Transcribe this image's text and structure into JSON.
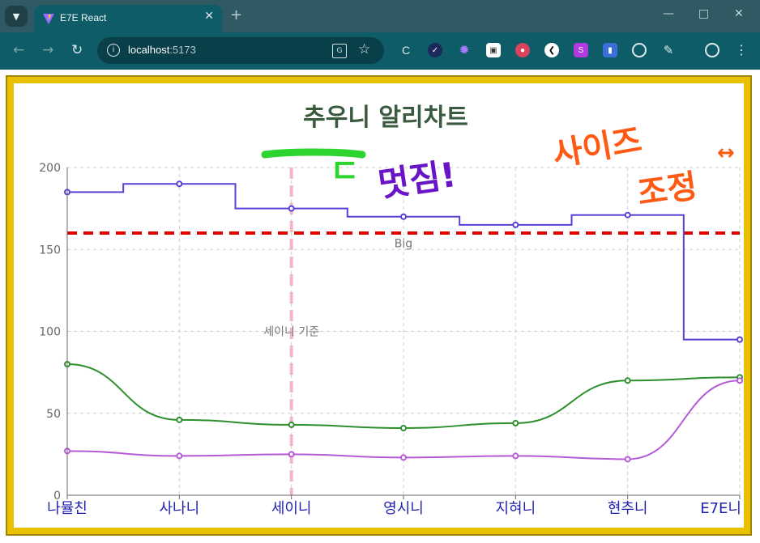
{
  "browser": {
    "tab_title": "E7E React",
    "tab_close": "✕",
    "new_tab": "+",
    "url_host": "localhost",
    "url_port": ":5173",
    "icons": {
      "tab_search": "chevron-down-icon",
      "back": "back-arrow-icon",
      "forward": "forward-arrow-icon",
      "reload": "reload-icon",
      "site_info": "info-icon",
      "translate": "translate-icon",
      "bookmark": "star-icon",
      "profile": "profile-icon",
      "menu": "kebab-menu-icon"
    },
    "colors": {
      "titlebar": "#2f5a63",
      "toolbar": "#0e5c68",
      "omnibox": "#083f48"
    }
  },
  "page": {
    "frame_color": "#e8c200",
    "annotations": {
      "green_mark": "ㅡ",
      "green_mark2": "ㄷ",
      "purple_text": "멋짐!",
      "orange_line1": "사이즈",
      "orange_line2": "조정",
      "orange_arrow": "↔"
    }
  },
  "chart_data": {
    "type": "line",
    "title": "추우니 알리차트",
    "categories": [
      "나뮬친",
      "사나니",
      "세이니",
      "영시니",
      "지혀니",
      "현추니",
      "E7E니"
    ],
    "ylim": [
      0,
      200
    ],
    "yticks": [
      0,
      50,
      100,
      150,
      200
    ],
    "grid": true,
    "series": [
      {
        "values": [
          185,
          190,
          175,
          170,
          165,
          171,
          95
        ],
        "color": "#5a3fd6",
        "interpolation": "step"
      },
      {
        "values": [
          80,
          46,
          43,
          41,
          44,
          70,
          72
        ],
        "color": "#2f8f2f",
        "interpolation": "smooth"
      },
      {
        "values": [
          27,
          24,
          25,
          23,
          24,
          22,
          70
        ],
        "color": "#b65ad6",
        "interpolation": "smooth"
      }
    ],
    "reference_lines": [
      {
        "axis": "y",
        "value": 160,
        "label": "Big",
        "color": "#e00000"
      },
      {
        "axis": "x",
        "category": "세이니",
        "label": "세이니 기준",
        "color": "#f4b6c4"
      }
    ],
    "tick_display": [
      "나뮬친",
      "사나니",
      "세이니",
      "영시니",
      "지혀니",
      "현추니",
      "E7E니"
    ]
  }
}
